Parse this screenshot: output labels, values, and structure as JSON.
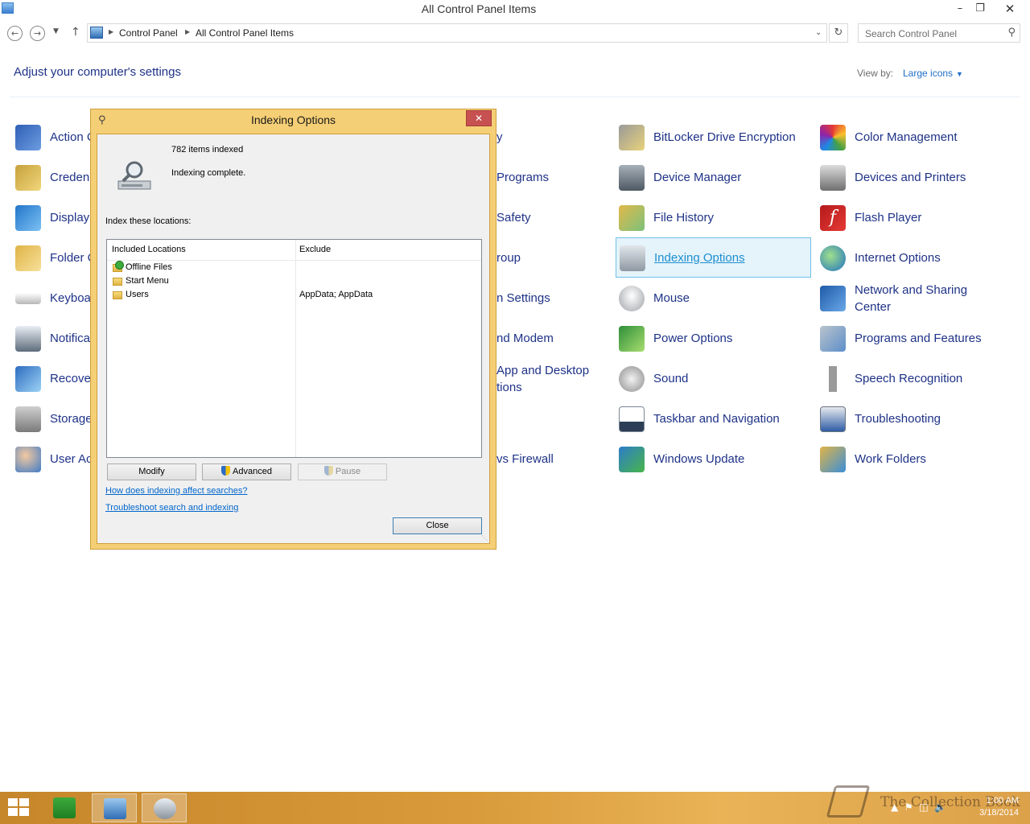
{
  "window": {
    "title": "All Control Panel Items"
  },
  "address": {
    "crumbs": [
      "Control Panel",
      "All Control Panel Items"
    ],
    "search_placeholder": "Search Control Panel"
  },
  "header": {
    "title": "Adjust your computer's settings",
    "view_by_label": "View by:",
    "view_mode": "Large icons"
  },
  "items": {
    "action_center": "Action C",
    "credential_manager": "Creden",
    "display": "Display",
    "folder_options": "Folder C",
    "keyboard": "Keyboa",
    "notification": "Notifica",
    "recovery": "Recove",
    "storage": "Storage",
    "user_accounts": "User Ac",
    "c2_1": "y",
    "c2_2": "Programs",
    "c2_3": "Safety",
    "c2_4": "roup",
    "c2_5": "n Settings",
    "c2_6": "nd Modem",
    "c2_7a": "App and Desktop",
    "c2_7b": "tions",
    "c2_9": "vs Firewall",
    "bitlocker": "BitLocker Drive Encryption",
    "device_manager": "Device Manager",
    "file_history": "File History",
    "indexing_options": "Indexing Options",
    "mouse": "Mouse",
    "power_options": "Power Options",
    "sound": "Sound",
    "taskbar_navigation": "Taskbar and Navigation",
    "windows_update": "Windows Update",
    "color_management": "Color Management",
    "devices_printers": "Devices and Printers",
    "flash_player": "Flash Player",
    "internet_options": "Internet Options",
    "network_sharing_1": "Network and Sharing",
    "network_sharing_2": "Center",
    "programs_features": "Programs and Features",
    "speech_recognition": "Speech Recognition",
    "troubleshooting": "Troubleshooting",
    "work_folders": "Work Folders"
  },
  "dialog": {
    "title": "Indexing Options",
    "items_indexed": "782 items indexed",
    "status": "Indexing complete.",
    "index_label": "Index these locations:",
    "col_included": "Included Locations",
    "col_exclude": "Exclude",
    "locations": [
      {
        "name": "Offline Files",
        "exclude": ""
      },
      {
        "name": "Start Menu",
        "exclude": ""
      },
      {
        "name": "Users",
        "exclude": "AppData; AppData"
      }
    ],
    "btn_modify": "Modify",
    "btn_advanced": "Advanced",
    "btn_pause": "Pause",
    "link_affect": "How does indexing affect searches?",
    "link_troubleshoot": "Troubleshoot search and indexing",
    "btn_close": "Close"
  },
  "taskbar": {
    "watermark": "The Collection Book",
    "time": "1:00 AM",
    "date": "3/18/2014"
  }
}
